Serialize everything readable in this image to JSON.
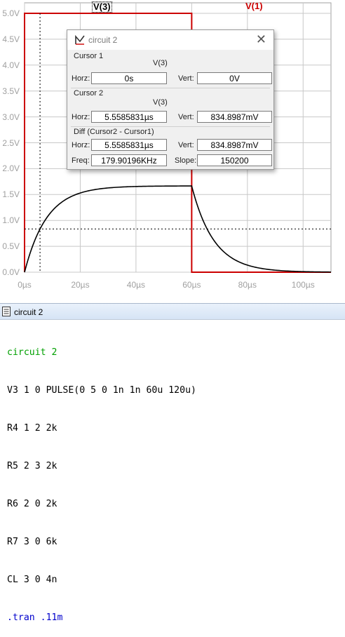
{
  "plot": {
    "trace_labels": {
      "v3": "V(3)",
      "v1": "V(1)"
    },
    "y_ticks": [
      "5.0V",
      "4.5V",
      "4.0V",
      "3.5V",
      "3.0V",
      "2.5V",
      "2.0V",
      "1.5V",
      "1.0V",
      "0.5V",
      "0.0V"
    ],
    "x_ticks": [
      "0µs",
      "20µs",
      "40µs",
      "60µs",
      "80µs",
      "100µs"
    ],
    "colors": {
      "v1": "#cc0000",
      "v3": "#000000",
      "grid": "#c8c8c8",
      "axis_text": "#a0a0a0"
    }
  },
  "cursor_dialog": {
    "title": "circuit 2",
    "close_icon": "close-icon",
    "cursor1": {
      "label": "Cursor 1",
      "trace": "V(3)",
      "horz_label": "Horz:",
      "horz": "0s",
      "vert_label": "Vert:",
      "vert": "0V"
    },
    "cursor2": {
      "label": "Cursor 2",
      "trace": "V(3)",
      "horz_label": "Horz:",
      "horz": "5.5585831µs",
      "vert_label": "Vert:",
      "vert": "834.8987mV"
    },
    "diff": {
      "label": "Diff (Cursor2 - Cursor1)",
      "horz_label": "Horz:",
      "horz": "5.5585831µs",
      "vert_label": "Vert:",
      "vert": "834.8987mV",
      "freq_label": "Freq:",
      "freq": "179.90196KHz",
      "slope_label": "Slope:",
      "slope": "150200"
    }
  },
  "netlist_window": {
    "title": "circuit 2",
    "lines": [
      "circuit 2",
      "V3 1 0 PULSE(0 5 0 1n 1n 60u 120u)",
      "R4 1 2 2k",
      "R5 2 3 2k",
      "R6 2 0 2k",
      "R7 3 0 6k",
      "CL 3 0 4n",
      ".tran .11m"
    ]
  }
}
